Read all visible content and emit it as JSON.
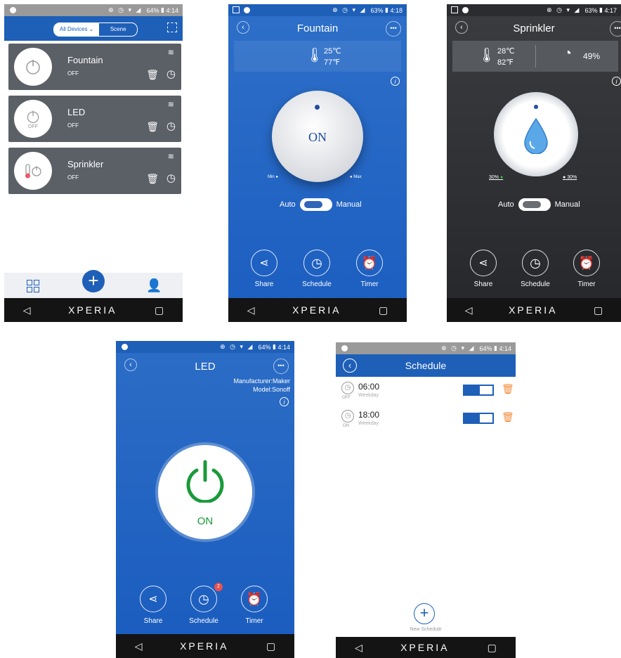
{
  "status_bar": {
    "p1": {
      "battery": "64%",
      "time": "4:14"
    },
    "p2": {
      "battery": "63%",
      "time": "4:18"
    },
    "p3": {
      "battery": "63%",
      "time": "4:17"
    },
    "p4": {
      "battery": "64%",
      "time": "4:14"
    },
    "p5": {
      "battery": "64%",
      "time": "4:14"
    }
  },
  "nav": {
    "brand": "XPERIA",
    "back_glyph": "◁",
    "recent_glyph": "▢"
  },
  "devices_screen": {
    "filter_label": "All Devices",
    "scene_label": "Scene",
    "devices": [
      {
        "name": "Fountain",
        "state": "OFF"
      },
      {
        "name": "LED",
        "state": "OFF",
        "avatar_text": "OFF"
      },
      {
        "name": "Sprinkler",
        "state": "OFF"
      }
    ]
  },
  "fountain_screen": {
    "title": "Fountain",
    "temp_c": "25℃",
    "temp_f": "77℉",
    "dial_label": "ON",
    "min_label": "Min",
    "max_label": "Max",
    "auto_label": "Auto",
    "manual_label": "Manual",
    "share_label": "Share",
    "schedule_label": "Schedule",
    "timer_label": "Timer"
  },
  "sprinkler_screen": {
    "title": "Sprinkler",
    "temp_c": "28℃",
    "temp_f": "82℉",
    "humidity": "49%",
    "left_pct": "30%",
    "right_pct": "30%",
    "auto_label": "Auto",
    "manual_label": "Manual",
    "share_label": "Share",
    "schedule_label": "Schedule",
    "timer_label": "Timer"
  },
  "led_screen": {
    "title": "LED",
    "manufacturer": "Manufacturer:Maker",
    "model": "Model:Sonoff",
    "power_label": "ON",
    "share_label": "Share",
    "schedule_label": "Schedule",
    "schedule_badge": "2",
    "timer_label": "Timer"
  },
  "schedule_screen": {
    "title": "Schedule",
    "items": [
      {
        "time": "06:00",
        "repeat": "Weekday",
        "action": "OFF"
      },
      {
        "time": "18:00",
        "repeat": "Weekday",
        "action": "ON"
      }
    ],
    "new_label": "New Schedule"
  },
  "colors": {
    "blue": "#1e5fb8",
    "dark": "#2a2c30",
    "green": "#1a9a3a",
    "orange": "#f08a3a"
  }
}
